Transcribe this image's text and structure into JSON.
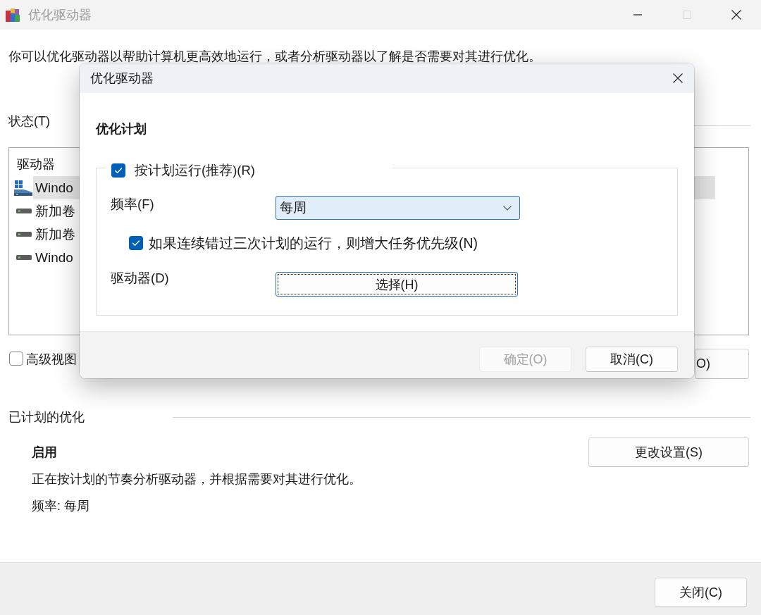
{
  "window": {
    "title": "优化驱动器",
    "active": false,
    "controls": [
      {
        "kind": "minimize",
        "disabled": false
      },
      {
        "kind": "maximize",
        "disabled": true
      },
      {
        "kind": "close",
        "disabled": false
      }
    ]
  },
  "description": "你可以优化驱动器以帮助计算机更高效地运行，或者分析驱动器以了解是否需要对其进行优化。",
  "status": {
    "label": "状态(T)",
    "list": {
      "columns": [
        "驱动器"
      ],
      "rows": [
        {
          "kind": "system",
          "name": "Windo",
          "selected": true
        },
        {
          "kind": "drive",
          "name": "新加卷",
          "selected": false
        },
        {
          "kind": "drive",
          "name": "新加卷",
          "selected": false
        },
        {
          "kind": "drive",
          "name": "Windo",
          "selected": false
        }
      ]
    }
  },
  "advanced_view": {
    "label": "高级视图",
    "checked": false
  },
  "buttons": [
    {
      "label": "O)",
      "disabled": false
    }
  ],
  "scheduled": {
    "heading": "已计划的优化",
    "state": "启用",
    "detail": "正在按计划的节奏分析驱动器，并根据需要对其进行优化。",
    "frequency": "频率: 每周",
    "button": "更改设置(S)"
  },
  "footer": {
    "buttons": [
      "关闭(C)"
    ]
  },
  "dialog": {
    "title": "优化驱动器",
    "controls": [
      {
        "kind": "close",
        "disabled": false
      }
    ],
    "heading": "优化计划",
    "run_on_schedule": {
      "label": "按计划运行(推荐)(R)",
      "checked": true
    },
    "frequency": {
      "label": "频率(F)",
      "value": "每周"
    },
    "priority": {
      "label": "如果连续错过三次计划的运行，则增大任务优先级(N)",
      "checked": true
    },
    "drives": {
      "label": "驱动器(D)",
      "button": "选择(H)",
      "focused": true
    },
    "buttons": [
      {
        "label": "确定(O)",
        "disabled": true
      },
      {
        "label": "取消(C)",
        "disabled": false
      }
    ]
  }
}
